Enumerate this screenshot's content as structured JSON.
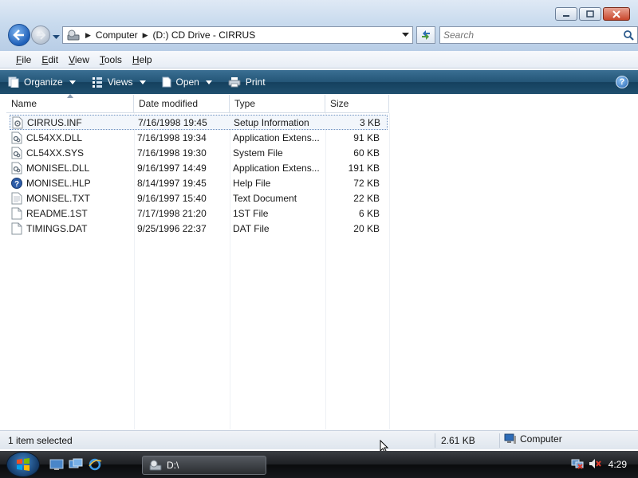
{
  "window": {
    "controls": [
      "minimize-icon",
      "maximize-icon",
      "close-icon"
    ]
  },
  "navigation": {
    "breadcrumb": [
      "Computer",
      "(D:) CD Drive - CIRRUS"
    ],
    "search_placeholder": "Search"
  },
  "menu": {
    "items": [
      "File",
      "Edit",
      "View",
      "Tools",
      "Help"
    ]
  },
  "toolbar": {
    "organize": "Organize",
    "views": "Views",
    "open": "Open",
    "print": "Print"
  },
  "columns": {
    "name": "Name",
    "date": "Date modified",
    "type": "Type",
    "size": "Size"
  },
  "files": [
    {
      "name": "CIRRUS.INF",
      "date": "7/16/1998 19:45",
      "type": "Setup Information",
      "size": "3 KB",
      "icon": "setup-file-icon",
      "selected": true
    },
    {
      "name": "CL54XX.DLL",
      "date": "7/16/1998 19:34",
      "type": "Application Extens...",
      "size": "91 KB",
      "icon": "dll-file-icon",
      "selected": false
    },
    {
      "name": "CL54XX.SYS",
      "date": "7/16/1998 19:30",
      "type": "System File",
      "size": "60 KB",
      "icon": "system-file-icon",
      "selected": false
    },
    {
      "name": "MONISEL.DLL",
      "date": "9/16/1997 14:49",
      "type": "Application Extens...",
      "size": "191 KB",
      "icon": "dll-file-icon",
      "selected": false
    },
    {
      "name": "MONISEL.HLP",
      "date": "8/14/1997 19:45",
      "type": "Help File",
      "size": "72 KB",
      "icon": "help-file-icon",
      "selected": false
    },
    {
      "name": "MONISEL.TXT",
      "date": "9/16/1997 15:40",
      "type": "Text Document",
      "size": "22 KB",
      "icon": "text-file-icon",
      "selected": false
    },
    {
      "name": "README.1ST",
      "date": "7/17/1998 21:20",
      "type": "1ST File",
      "size": "6 KB",
      "icon": "generic-file-icon",
      "selected": false
    },
    {
      "name": "TIMINGS.DAT",
      "date": "9/25/1996 22:37",
      "type": "DAT File",
      "size": "20 KB",
      "icon": "generic-file-icon",
      "selected": false
    }
  ],
  "status": {
    "selection": "1 item selected",
    "size": "2.61 KB",
    "location": "Computer"
  },
  "taskbar": {
    "task_label": "D:\\",
    "clock": "4:29"
  },
  "colors": {
    "toolbar_bg": "#20506f",
    "selection_border": "#6b8fbf",
    "taskbar_bg": "#16181c"
  }
}
